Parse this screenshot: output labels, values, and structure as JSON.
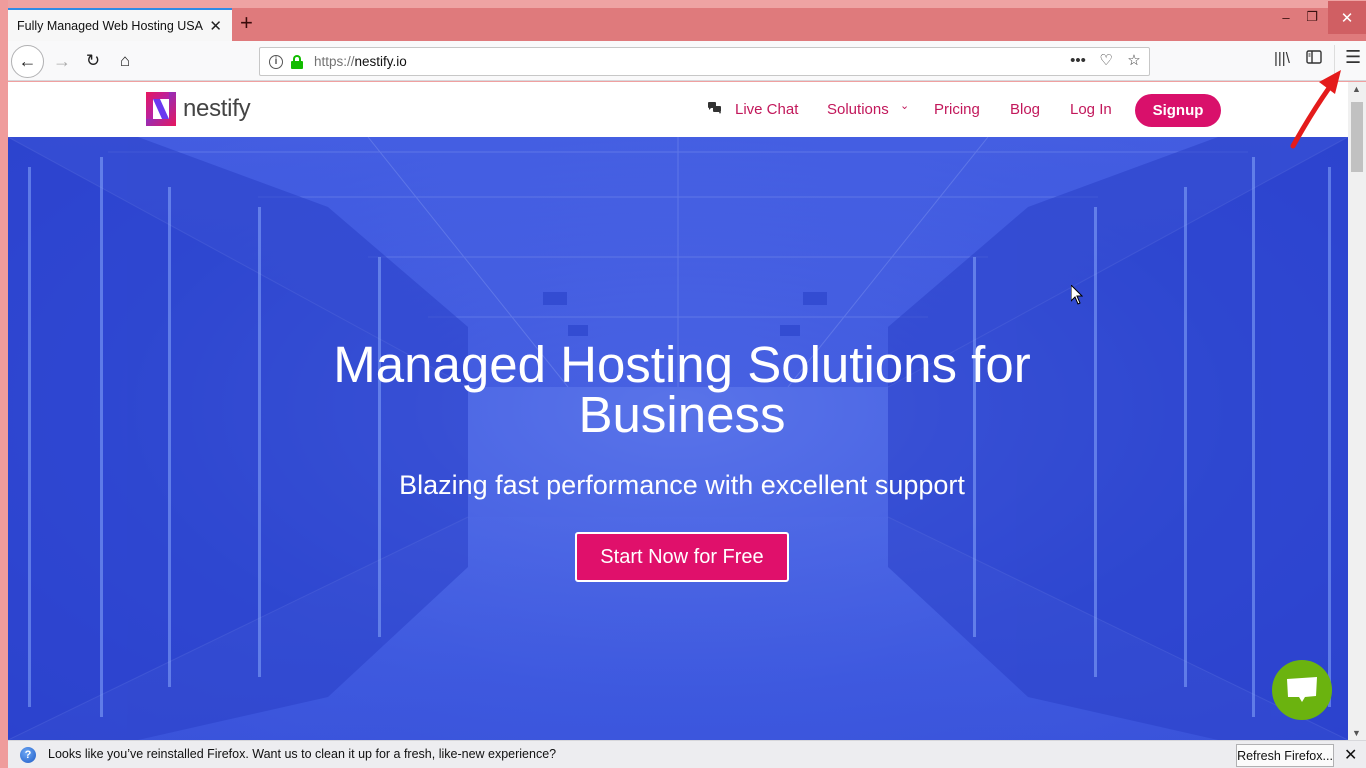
{
  "browser": {
    "tab": {
      "title": "Fully Managed Web Hosting USA | N",
      "close_label": "✕"
    },
    "new_tab_label": "+",
    "window_controls": {
      "minimize": "–",
      "maximize": "❐",
      "close": "✕"
    },
    "toolbar": {
      "back_icon": "←",
      "forward_icon": "→",
      "reload_icon": "↻",
      "home_icon": "⌂",
      "url": {
        "scheme": "https://",
        "host": "nestify.io"
      },
      "url_actions": {
        "more": "•••",
        "pocket": "♡",
        "bookmark": "☆"
      },
      "library_icon": "|||\\",
      "sidebar_icon": "▯",
      "menu_icon": "☰"
    },
    "notification": {
      "text": "Looks like you’ve reinstalled Firefox. Want us to clean it up for a fresh, like-new experience?",
      "button_label": "Refresh Firefox...",
      "close_label": "✕",
      "icon": "?"
    }
  },
  "site": {
    "logo_text": "nestify",
    "nav": {
      "live_chat": "Live Chat",
      "solutions": "Solutions",
      "solutions_chevron": "⌄",
      "pricing": "Pricing",
      "blog": "Blog",
      "login": "Log In",
      "signup": "Signup"
    },
    "hero": {
      "title_line1": "Managed Hosting Solutions for",
      "title_line2": "Business",
      "subtitle": "Blazing fast performance with excellent support",
      "cta": "Start Now for Free"
    },
    "colors": {
      "accent": "#d9106b",
      "nav_link": "#c2185b",
      "hero_blue": "#3f5ae0",
      "chat_green": "#6bb30f"
    }
  }
}
